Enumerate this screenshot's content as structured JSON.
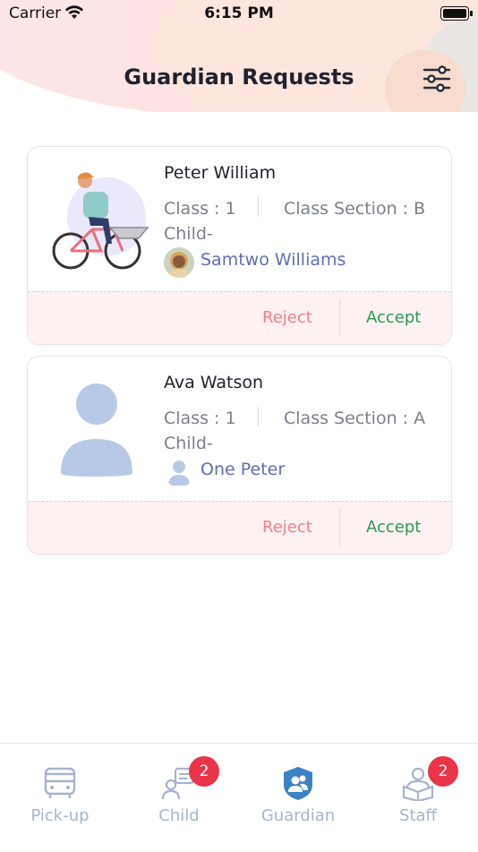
{
  "status_bar": {
    "carrier": "Carrier",
    "time": "6:15 PM"
  },
  "header": {
    "title": "Guardian Requests",
    "filter_icon": "sliders-icon"
  },
  "requests": [
    {
      "name": "Peter William",
      "class": "Class : 1",
      "section": "Class Section : B",
      "child_label": "Child-",
      "child_name": "Samtwo Williams",
      "reject_label": "Reject",
      "accept_label": "Accept"
    },
    {
      "name": "Ava Watson",
      "class": "Class : 1",
      "section": "Class Section : A",
      "child_label": "Child-",
      "child_name": "One Peter",
      "reject_label": "Reject",
      "accept_label": "Accept"
    }
  ],
  "tabs": [
    {
      "label": "Pick-up",
      "icon": "bus-icon"
    },
    {
      "label": "Child",
      "icon": "child-chat-icon",
      "badge": "2"
    },
    {
      "label": "Guardian",
      "icon": "guardian-shield-icon",
      "active": true
    },
    {
      "label": "Staff",
      "icon": "staff-icon",
      "badge": "2"
    }
  ],
  "colors": {
    "accept": "#2a9a52",
    "reject": "#f0808a",
    "child_link": "#5e6fb8",
    "badge": "#ea3548",
    "tab_inactive": "#a7b3cf",
    "tab_active_icon": "#3b82c4"
  }
}
